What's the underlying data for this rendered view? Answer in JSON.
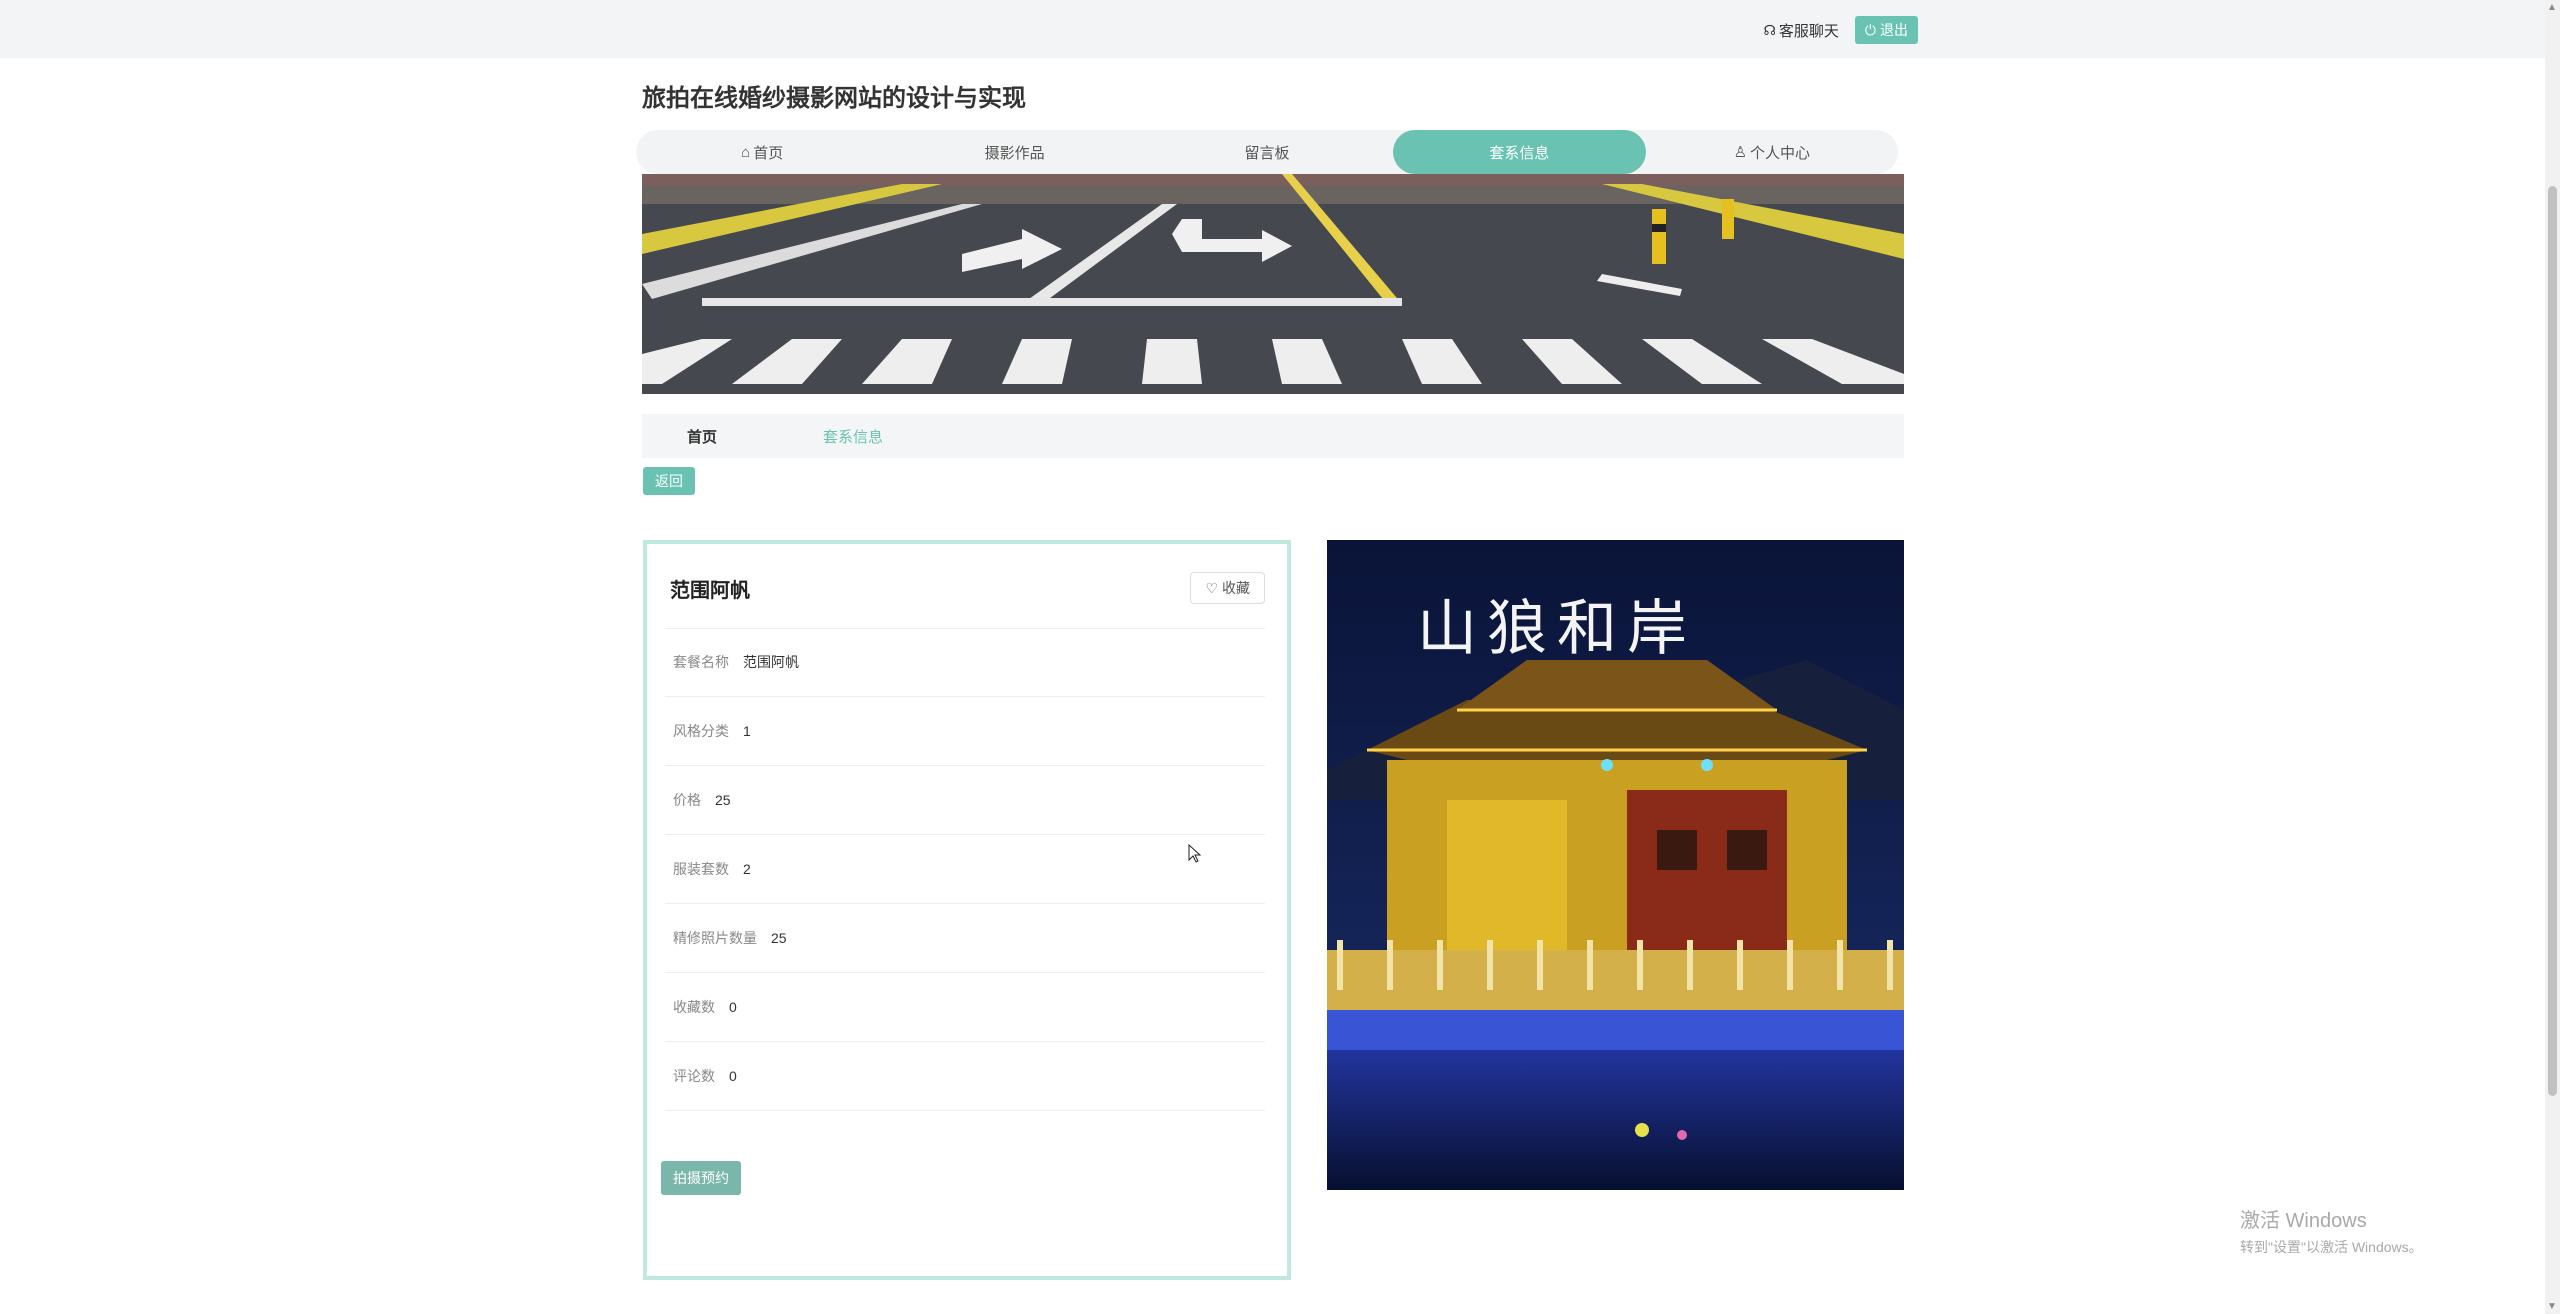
{
  "topbar": {
    "chat_label": "客服聊天",
    "logout_label": "退出"
  },
  "site": {
    "title": "旅拍在线婚纱摄影网站的设计与实现"
  },
  "nav": {
    "items": [
      {
        "label": "首页",
        "icon": "home-icon"
      },
      {
        "label": "摄影作品"
      },
      {
        "label": "留言板"
      },
      {
        "label": "套系信息",
        "active": true
      },
      {
        "label": "个人中心",
        "icon": "user-icon"
      }
    ]
  },
  "breadcrumb": {
    "home": "首页",
    "current": "套系信息"
  },
  "back_label": "返回",
  "detail": {
    "title": "范围阿帆",
    "favorite_label": "收藏",
    "fields": [
      {
        "label": "套餐名称",
        "value": "范围阿帆"
      },
      {
        "label": "风格分类",
        "value": "1"
      },
      {
        "label": "价格",
        "value": "25"
      },
      {
        "label": "服装套数",
        "value": "2"
      },
      {
        "label": "精修照片数量",
        "value": "25"
      },
      {
        "label": "收藏数",
        "value": "0"
      },
      {
        "label": "评论数",
        "value": "0"
      }
    ],
    "booking_label": "拍摄预约"
  },
  "photo": {
    "caption": "山狼和岸"
  },
  "watermark": {
    "line1": "激活 Windows",
    "line2": "转到\"设置\"以激活 Windows。"
  },
  "colors": {
    "accent": "#6ac3b2",
    "card_border": "#bfe8df"
  }
}
